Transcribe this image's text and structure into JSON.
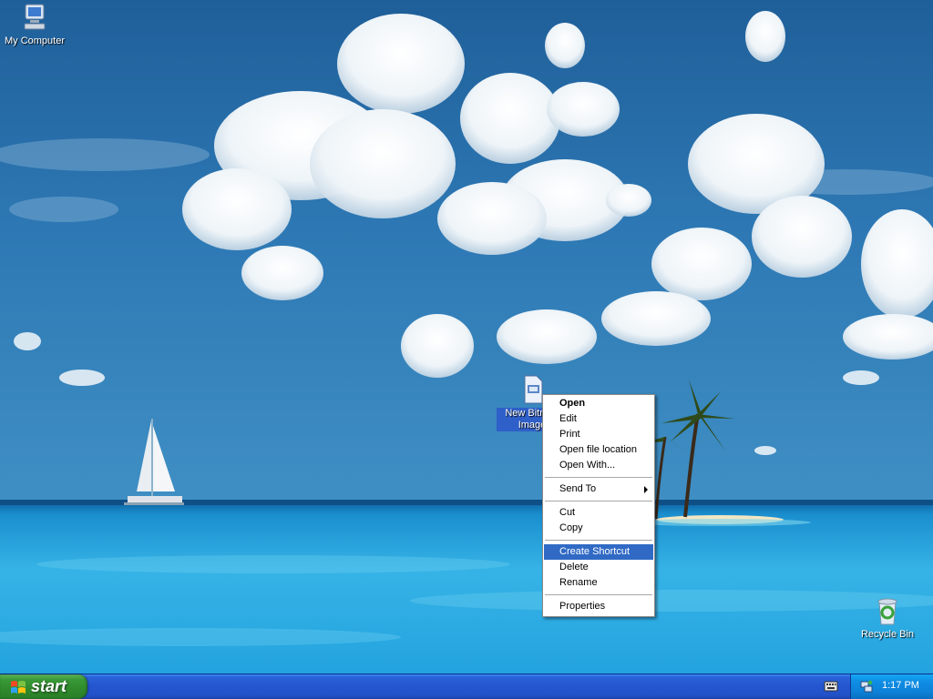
{
  "desktop": {
    "icons": [
      {
        "label": "My Computer"
      },
      {
        "label": "New Bitmap Image"
      },
      {
        "label": "Recycle Bin"
      }
    ]
  },
  "context_menu": {
    "items": {
      "open": "Open",
      "edit": "Edit",
      "print": "Print",
      "open_file_location": "Open file location",
      "open_with": "Open With...",
      "send_to": "Send To",
      "cut": "Cut",
      "copy": "Copy",
      "create_shortcut": "Create Shortcut",
      "delete": "Delete",
      "rename": "Rename",
      "properties": "Properties"
    },
    "highlighted": "create_shortcut"
  },
  "taskbar": {
    "start_label": "start",
    "clock": "1:17 PM"
  },
  "colors": {
    "menu_highlight": "#316ac5",
    "taskbar_blue": "#2555cf",
    "start_green": "#3a9a37",
    "tray_blue": "#0f8de4"
  }
}
